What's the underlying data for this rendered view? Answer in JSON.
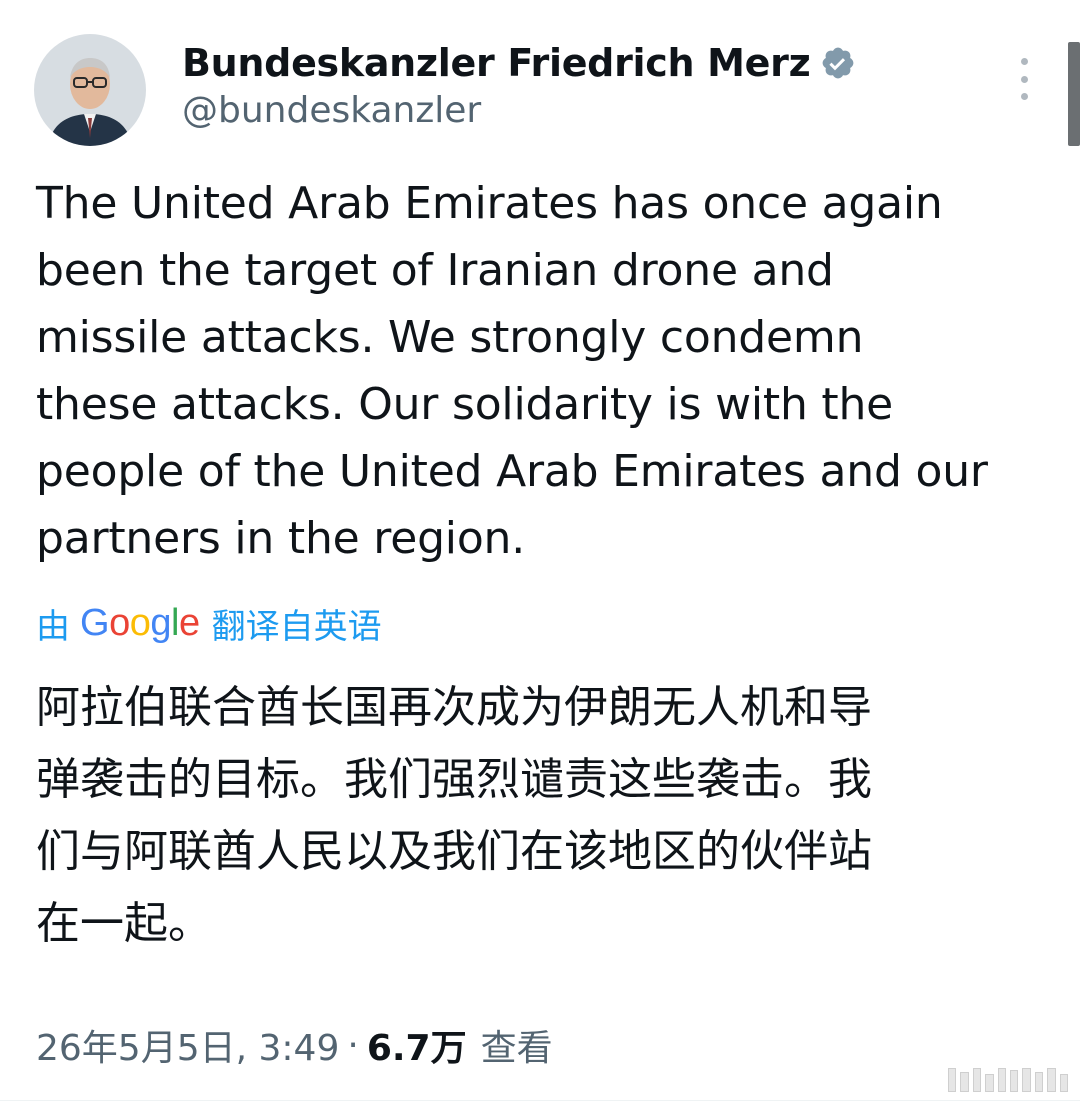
{
  "author": {
    "display_name": "Bundeskanzler Friedrich Merz",
    "handle": "@bundeskanzler",
    "verified_icon": "verified-badge-icon",
    "avatar": "profile-photo"
  },
  "tweet": {
    "text": "The United Arab Emirates has once again\nbeen the target of Iranian drone and\nmissile attacks. We strongly condemn\nthese attacks. Our solidarity is with the\npeople of the United Arab Emirates and our\npartners in the region."
  },
  "translation": {
    "by": "由",
    "provider": "Google",
    "label": "翻译自英语",
    "text": "阿拉伯联合酋长国再次成为伊朗无人机和导\n弹袭击的目标。我们强烈谴责这些袭击。我\n们与阿联酋人民以及我们在该地区的伙伴站\n在一起。"
  },
  "meta": {
    "timestamp": "26年5月5日, 3:49",
    "separator": "·",
    "views_count": "6.7万",
    "views_label": "查看"
  },
  "colors": {
    "link_blue": "#1d9bf0",
    "secondary_text": "#536471",
    "primary_text": "#0f1419",
    "verified_badge": "#829aab"
  }
}
